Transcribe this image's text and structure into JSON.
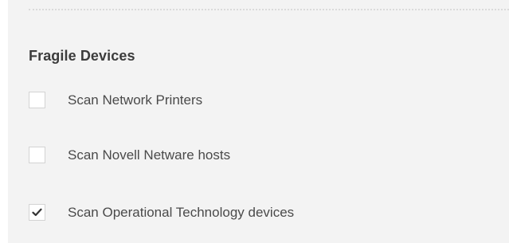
{
  "section": {
    "title": "Fragile Devices",
    "options": [
      {
        "label": "Scan Network Printers",
        "checked": false
      },
      {
        "label": "Scan Novell Netware hosts",
        "checked": false
      },
      {
        "label": "Scan Operational Technology devices",
        "checked": true
      }
    ]
  },
  "colors": {
    "panel_background": "#f3f3f3",
    "checkbox_border": "#d3d3d3",
    "checkmark": "#333333",
    "title_text": "#3c3c3c",
    "label_text": "#4a4a4a"
  }
}
